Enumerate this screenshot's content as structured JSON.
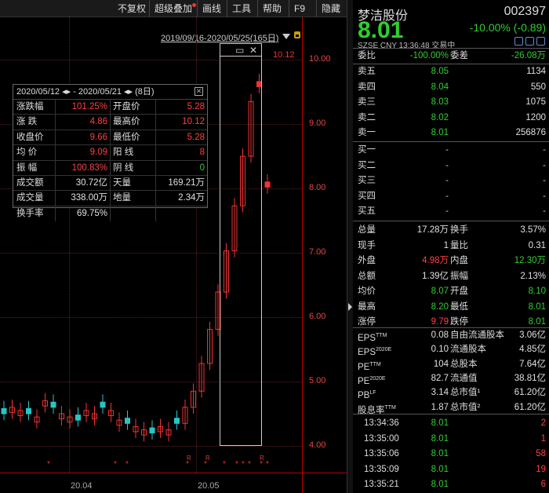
{
  "toolbar": {
    "items": [
      "不复权",
      "超级叠加",
      "画线",
      "工具",
      "帮助",
      "F9",
      "隐藏"
    ]
  },
  "range": "2019/09/16-2020/05/25(165日)",
  "yaxis": [
    "10.00",
    "9.00",
    "8.00",
    "7.00",
    "6.00",
    "5.00",
    "4.00"
  ],
  "xaxis": [
    "20.04",
    "20.05"
  ],
  "high_label": "10.12",
  "tip": {
    "header": "2020/05/12 ◂▸ - 2020/05/21 ◂▸  (8日)",
    "rows": [
      [
        "涨跌幅",
        "101.25%",
        "开盘价",
        "5.28"
      ],
      [
        "涨  跌",
        "4.86",
        "最高价",
        "10.12"
      ],
      [
        "收盘价",
        "9.66",
        "最低价",
        "5.28"
      ],
      [
        "均  价",
        "9.09",
        "阳  线",
        "8"
      ],
      [
        "振  幅",
        "100.83%",
        "阴  线",
        "0"
      ],
      [
        "成交额",
        "30.72亿",
        "天量",
        "169.21万"
      ],
      [
        "成交量",
        "338.00万",
        "地量",
        "2.34万"
      ],
      [
        "换手率",
        "69.75%",
        "",
        ""
      ]
    ]
  },
  "stock": {
    "name": "梦洁股份",
    "code": "002397",
    "price": "8.01",
    "change": "-10.00%  (-0.89)",
    "meta": "SZSE  CNY  13:36:48  交易中"
  },
  "webi": {
    "l1": "委比",
    "v1": "-100.00%",
    "l2": "委差",
    "v2": "-26.08万"
  },
  "sells": [
    [
      "卖五",
      "8.05",
      "1134"
    ],
    [
      "卖四",
      "8.04",
      "550"
    ],
    [
      "卖三",
      "8.03",
      "1075"
    ],
    [
      "卖二",
      "8.02",
      "1200"
    ],
    [
      "卖一",
      "8.01",
      "256876"
    ]
  ],
  "buys": [
    [
      "买一",
      "-",
      "-"
    ],
    [
      "买二",
      "-",
      "-"
    ],
    [
      "买三",
      "-",
      "-"
    ],
    [
      "买四",
      "-",
      "-"
    ],
    [
      "买五",
      "-",
      "-"
    ]
  ],
  "stats": [
    [
      "总量",
      "17.28万",
      "换手",
      "3.57%"
    ],
    [
      "现手",
      "1",
      "量比",
      "0.31"
    ],
    [
      "外盘",
      "4.98万",
      "内盘",
      "12.30万"
    ],
    [
      "总额",
      "1.39亿",
      "振幅",
      "2.13%"
    ],
    [
      "均价",
      "8.07",
      "开盘",
      "8.10"
    ],
    [
      "最高",
      "8.20",
      "最低",
      "8.01"
    ],
    [
      "涨停",
      "9.79",
      "跌停",
      "8.01"
    ]
  ],
  "fund": [
    [
      "EPS",
      "TTM",
      "0.08",
      "自由流通股本",
      "3.06亿"
    ],
    [
      "EPS",
      "2020E",
      "0.10",
      "流通股本",
      "4.85亿"
    ],
    [
      "PE",
      "TTM",
      "104",
      "总股本",
      "7.64亿"
    ],
    [
      "PE",
      "2020E",
      "82.7",
      "流通值",
      "38.81亿"
    ],
    [
      "PB",
      "LF",
      "3.14",
      "总市值¹",
      "61.20亿"
    ],
    [
      "股息率",
      "TTM",
      "1.87",
      "总市值²",
      "61.20亿"
    ]
  ],
  "ticks": [
    [
      "13:34:36",
      "8.01",
      "2"
    ],
    [
      "13:35:00",
      "8.01",
      "1"
    ],
    [
      "13:35:06",
      "8.01",
      "58"
    ],
    [
      "13:35:09",
      "8.01",
      "19"
    ],
    [
      "13:35:21",
      "8.01",
      "6"
    ]
  ],
  "chart_data": {
    "type": "candlestick",
    "visible_close_approx": [
      4.5,
      4.6,
      4.55,
      4.5,
      4.45,
      4.7,
      4.6,
      4.5,
      4.45,
      4.4,
      4.55,
      4.5,
      4.6,
      4.55,
      4.4,
      4.35,
      4.3,
      4.25,
      4.2,
      4.3,
      4.25,
      4.35,
      4.6,
      4.85,
      5.28,
      5.81,
      6.39,
      7.03,
      7.73,
      8.5,
      9.35,
      9.66,
      8.1
    ],
    "ylim": [
      3.8,
      10.4
    ]
  }
}
